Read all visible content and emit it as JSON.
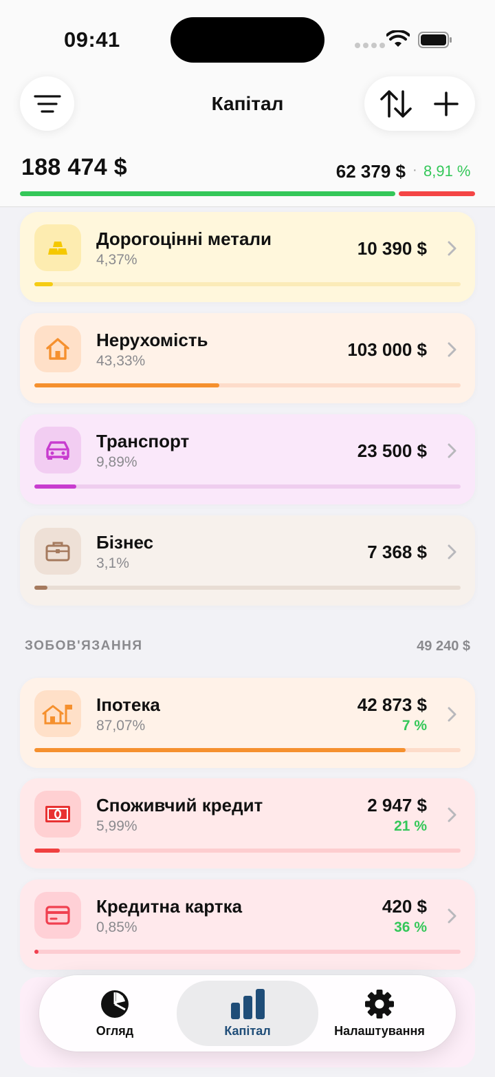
{
  "status": {
    "time": "09:41"
  },
  "header": {
    "title": "Капітал"
  },
  "summary": {
    "total": "188 474 $",
    "liabilities": "62 379 $",
    "separator": "·",
    "ratio": "8,91 %"
  },
  "assets": [
    {
      "name": "Дорогоцінні метали",
      "percent": "4,37%",
      "amount": "10 390 $",
      "fill": 0.0437,
      "bg": "#fff7dc",
      "icon_bg": "#fdecb0",
      "track": "#fbebb8",
      "bar": "#f5cc14",
      "icon": "gold-bars-icon"
    },
    {
      "name": "Нерухомість",
      "percent": "43,33%",
      "amount": "103 000 $",
      "fill": 0.4333,
      "bg": "#fff2e8",
      "icon_bg": "#ffe0c8",
      "track": "#fddcca",
      "bar": "#f5902e",
      "icon": "house-icon"
    },
    {
      "name": "Транспорт",
      "percent": "9,89%",
      "amount": "23 500 $",
      "fill": 0.0989,
      "bg": "#fae8fa",
      "icon_bg": "#f2cdf2",
      "track": "#efcdef",
      "bar": "#c83ccf",
      "icon": "car-icon"
    },
    {
      "name": "Бізнес",
      "percent": "3,1%",
      "amount": "7 368 $",
      "fill": 0.031,
      "bg": "#f7f1ec",
      "icon_bg": "#eee0d6",
      "track": "#e8ddd4",
      "bar": "#a57a5e",
      "icon": "briefcase-icon"
    }
  ],
  "liabilities_section": {
    "title": "ЗОБОВ'ЯЗАННЯ",
    "total": "49 240 $"
  },
  "liabilities": [
    {
      "name": "Іпотека",
      "percent": "87,07%",
      "amount": "42 873 $",
      "rate": "7 %",
      "fill": 0.8707,
      "bg": "#fff2e8",
      "icon_bg": "#ffe0c8",
      "track": "#fddcca",
      "bar": "#f5902e",
      "icon": "mortgage-house-icon"
    },
    {
      "name": "Споживчий кредит",
      "percent": "5,99%",
      "amount": "2 947 $",
      "rate": "21 %",
      "fill": 0.0599,
      "bg": "#ffe9ea",
      "icon_bg": "#ffd0d2",
      "track": "#fdcdcf",
      "bar": "#f04040",
      "icon": "cash-icon"
    },
    {
      "name": "Кредитна картка",
      "percent": "0,85%",
      "amount": "420 $",
      "rate": "36 %",
      "fill": 0.0085,
      "bg": "#ffe9ec",
      "icon_bg": "#ffd0d6",
      "track": "#fdcdd2",
      "bar": "#f04050",
      "icon": "credit-card-icon"
    }
  ],
  "tabs": [
    {
      "label": "Огляд",
      "icon": "pie-chart-icon"
    },
    {
      "label": "Капітал",
      "icon": "bar-chart-icon"
    },
    {
      "label": "Налаштування",
      "icon": "gear-icon"
    }
  ],
  "colors": {
    "positive": "#34c759",
    "negative": "#f44545",
    "tab_active": "#1f4d78"
  }
}
